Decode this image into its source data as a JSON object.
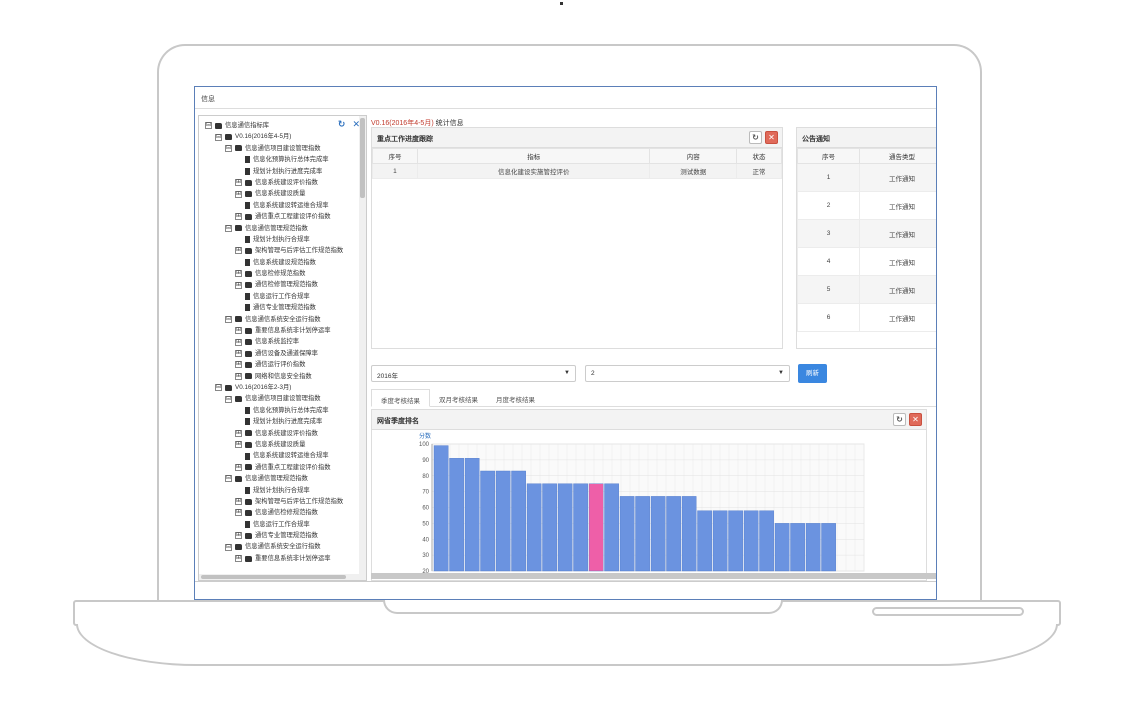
{
  "window": {
    "title": "信息"
  },
  "tree": {
    "items": [
      {
        "label": "信息通信指标库",
        "level": 0,
        "toggle": "⊟",
        "icon": "folder"
      },
      {
        "label": "V0.16(2016年4-5月)",
        "level": 1,
        "toggle": "⊟",
        "icon": "folder"
      },
      {
        "label": "信息通信项目建设管理指数",
        "level": 2,
        "toggle": "⊟",
        "icon": "folder"
      },
      {
        "label": "信息化预算执行总体完成率",
        "level": 3,
        "toggle": "",
        "icon": "file"
      },
      {
        "label": "规划计划执行进度完成率",
        "level": 3,
        "toggle": "",
        "icon": "file"
      },
      {
        "label": "信息系统建设评价指数",
        "level": 3,
        "toggle": "⊞",
        "icon": "folder"
      },
      {
        "label": "信息系统建设质量",
        "level": 3,
        "toggle": "⊞",
        "icon": "folder"
      },
      {
        "label": "信息系统建设转运维合规率",
        "level": 3,
        "toggle": "",
        "icon": "file"
      },
      {
        "label": "通信重点工程建设评价指数",
        "level": 3,
        "toggle": "⊞",
        "icon": "folder"
      },
      {
        "label": "信息通信管理规范指数",
        "level": 2,
        "toggle": "⊟",
        "icon": "folder"
      },
      {
        "label": "规划计划执行合规率",
        "level": 3,
        "toggle": "",
        "icon": "file"
      },
      {
        "label": "架构管理与后评估工作规范指数",
        "level": 3,
        "toggle": "⊞",
        "icon": "folder"
      },
      {
        "label": "信息系统建设规范指数",
        "level": 3,
        "toggle": "",
        "icon": "file"
      },
      {
        "label": "信息检修规范指数",
        "level": 3,
        "toggle": "⊞",
        "icon": "folder"
      },
      {
        "label": "通信检修管理规范指数",
        "level": 3,
        "toggle": "⊞",
        "icon": "folder"
      },
      {
        "label": "信息运行工作合规率",
        "level": 3,
        "toggle": "",
        "icon": "file"
      },
      {
        "label": "通信专业管理规范指数",
        "level": 3,
        "toggle": "",
        "icon": "file"
      },
      {
        "label": "信息通信系统安全运行指数",
        "level": 2,
        "toggle": "⊟",
        "icon": "folder"
      },
      {
        "label": "重要信息系统非计划停运率",
        "level": 3,
        "toggle": "⊞",
        "icon": "folder"
      },
      {
        "label": "信息系统监控率",
        "level": 3,
        "toggle": "⊞",
        "icon": "folder"
      },
      {
        "label": "通信设备及通道保障率",
        "level": 3,
        "toggle": "⊞",
        "icon": "folder"
      },
      {
        "label": "通信运行评价指数",
        "level": 3,
        "toggle": "⊞",
        "icon": "folder"
      },
      {
        "label": "网络和信息安全指数",
        "level": 3,
        "toggle": "⊞",
        "icon": "folder"
      },
      {
        "label": "V0.16(2016年2-3月)",
        "level": 1,
        "toggle": "⊟",
        "icon": "folder"
      },
      {
        "label": "信息通信项目建设管理指数",
        "level": 2,
        "toggle": "⊟",
        "icon": "folder"
      },
      {
        "label": "信息化预算执行总体完成率",
        "level": 3,
        "toggle": "",
        "icon": "file"
      },
      {
        "label": "规划计划执行进度完成率",
        "level": 3,
        "toggle": "",
        "icon": "file"
      },
      {
        "label": "信息系统建设评价指数",
        "level": 3,
        "toggle": "⊞",
        "icon": "folder"
      },
      {
        "label": "信息系统建设质量",
        "level": 3,
        "toggle": "⊞",
        "icon": "folder"
      },
      {
        "label": "信息系统建设转运维合规率",
        "level": 3,
        "toggle": "",
        "icon": "file"
      },
      {
        "label": "通信重点工程建设评价指数",
        "level": 3,
        "toggle": "⊞",
        "icon": "folder"
      },
      {
        "label": "信息通信管理规范指数",
        "level": 2,
        "toggle": "⊟",
        "icon": "folder"
      },
      {
        "label": "规划计划执行合规率",
        "level": 3,
        "toggle": "",
        "icon": "file"
      },
      {
        "label": "架构管理与后评估工作规范指数",
        "level": 3,
        "toggle": "⊞",
        "icon": "folder"
      },
      {
        "label": "信息通信检修规范指数",
        "level": 3,
        "toggle": "⊞",
        "icon": "folder"
      },
      {
        "label": "信息运行工作合规率",
        "level": 3,
        "toggle": "",
        "icon": "file"
      },
      {
        "label": "通信专业管理规范指数",
        "level": 3,
        "toggle": "⊞",
        "icon": "folder"
      },
      {
        "label": "信息通信系统安全运行指数",
        "level": 2,
        "toggle": "⊟",
        "icon": "folder"
      },
      {
        "label": "重要信息系统非计划停运率",
        "level": 3,
        "toggle": "⊞",
        "icon": "folder"
      }
    ]
  },
  "breadcrumb": {
    "version": "V0.16(2016年4-5月)",
    "suffix": " 统计信息"
  },
  "progress_panel": {
    "title": "重点工作进度跟踪",
    "columns": [
      "序号",
      "指标",
      "内容",
      "状态"
    ],
    "rows": [
      [
        "1",
        "信息化建设实施管控评价",
        "测试数据",
        "正常"
      ]
    ]
  },
  "notice_panel": {
    "title": "公告通知",
    "columns": [
      "序号",
      "通告类型"
    ],
    "rows": [
      [
        "1",
        "工作通知"
      ],
      [
        "2",
        "工作通知"
      ],
      [
        "3",
        "工作通知"
      ],
      [
        "4",
        "工作通知"
      ],
      [
        "5",
        "工作通知"
      ],
      [
        "6",
        "工作通知"
      ]
    ]
  },
  "filters": {
    "year": "2016年",
    "period": "2",
    "refresh_label": "刷新"
  },
  "tabs": [
    {
      "label": "季度考核结果",
      "active": true
    },
    {
      "label": "双月考核结果",
      "active": false
    },
    {
      "label": "月度考核结果",
      "active": false
    }
  ],
  "ranking_panel": {
    "title": "网省季度排名"
  },
  "chart_data": {
    "type": "bar",
    "ylabel": "分数",
    "y_ticks": [
      "100",
      "90",
      "80",
      "70",
      "60",
      "50",
      "40",
      "30",
      "20"
    ],
    "ylim": [
      20,
      100
    ],
    "values": [
      99,
      91,
      91,
      83,
      83,
      83,
      75,
      75,
      75,
      75,
      75,
      75,
      67,
      67,
      67,
      67,
      67,
      58,
      58,
      58,
      58,
      58,
      50,
      50,
      50,
      50
    ],
    "highlight_index": 10,
    "bar_color": "#6b93e0",
    "highlight_color": "#ee5fa8",
    "grid": true
  }
}
